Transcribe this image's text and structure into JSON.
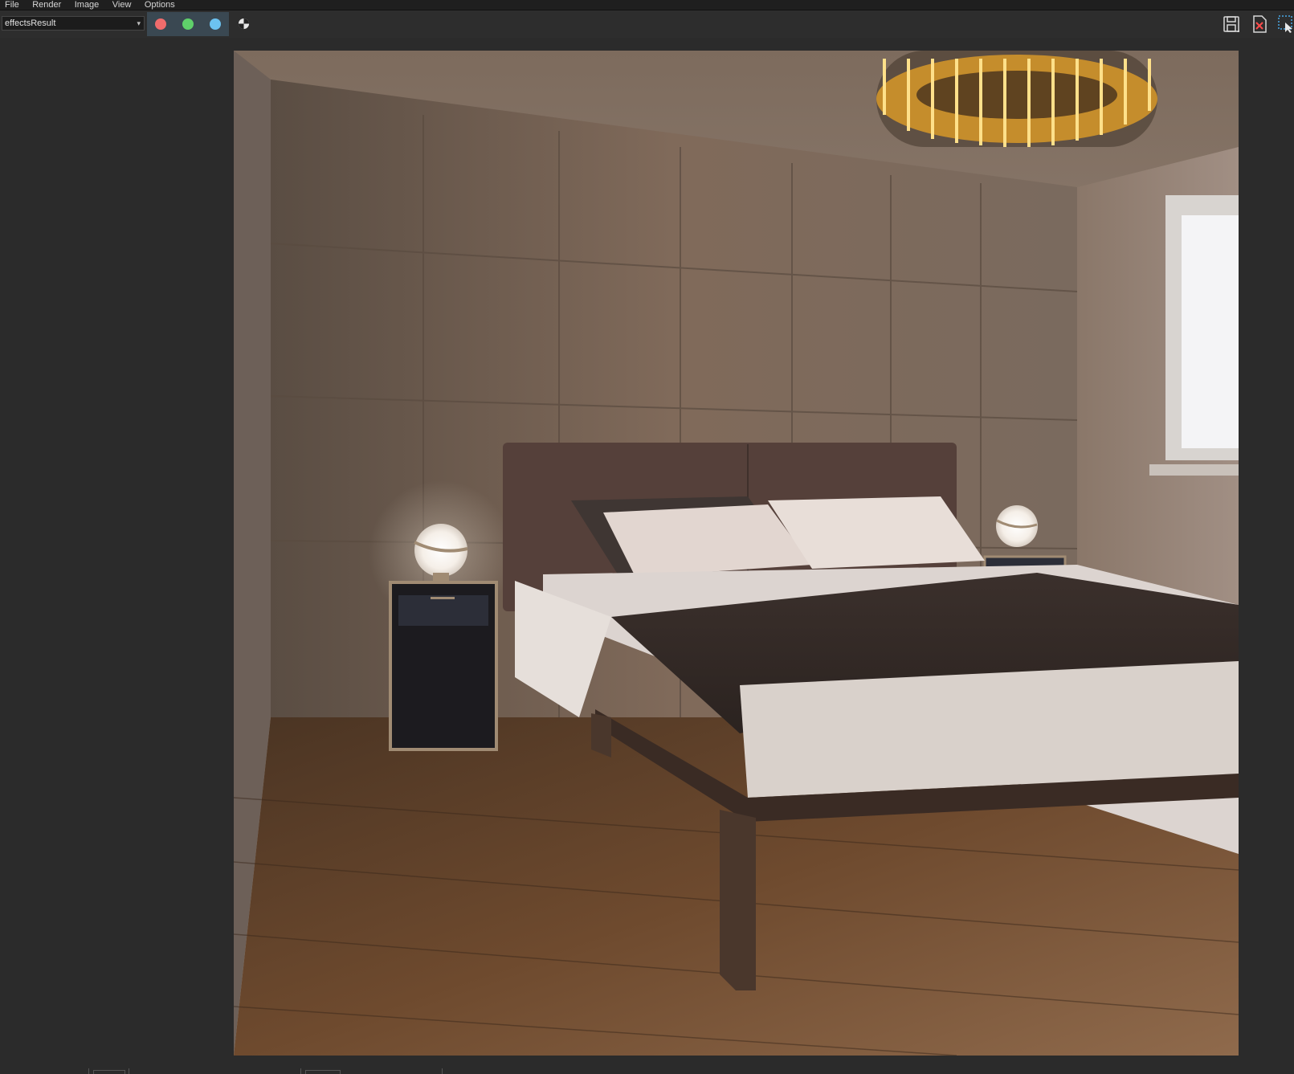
{
  "menu": {
    "items": [
      "File",
      "Render",
      "Image",
      "View",
      "Options"
    ]
  },
  "toolbar": {
    "channel_select": {
      "value": "effectsResult"
    },
    "channel_buttons": [
      {
        "name": "red-channel",
        "color": "#f06c6c"
      },
      {
        "name": "green-channel",
        "color": "#5fd06a"
      },
      {
        "name": "blue-channel",
        "color": "#6cc2f0"
      }
    ],
    "icons": [
      "monochrome-icon",
      "save-image-icon",
      "clear-image-icon",
      "region-render-icon"
    ]
  },
  "render": {
    "scene": "bedroom interior render"
  },
  "colors": {
    "background": "#2b2b2b",
    "menubar": "#1f1f1f",
    "channel_button_active_bg": "#3a4852",
    "accent": "#4aa8e6"
  }
}
